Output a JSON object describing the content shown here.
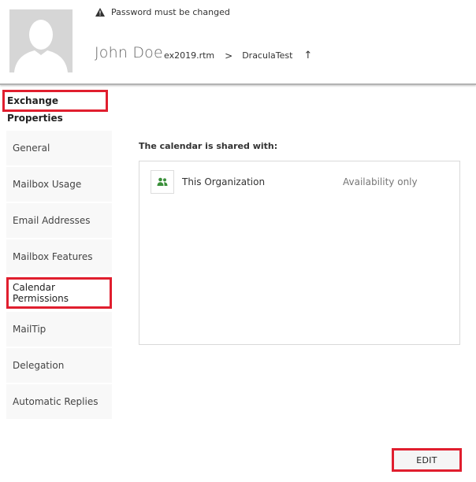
{
  "header": {
    "warning": "Password must be changed",
    "user_name": "John Doe",
    "breadcrumb": [
      "ex2019.rtm",
      "DraculaTest"
    ],
    "breadcrumb_sep": ">",
    "up_glyph": "↑",
    "avatar_icon": "person-silhouette-icon",
    "warning_icon": "warning-triangle-icon"
  },
  "section_title": "Exchange Properties",
  "nav": {
    "items": [
      {
        "label": "General"
      },
      {
        "label": "Mailbox Usage"
      },
      {
        "label": "Email Addresses"
      },
      {
        "label": "Mailbox Features"
      },
      {
        "label": "Calendar Permissions",
        "active": true
      },
      {
        "label": "MailTip"
      },
      {
        "label": "Delegation"
      },
      {
        "label": "Automatic Replies"
      }
    ]
  },
  "calendar": {
    "label": "The calendar is shared with:",
    "entries": [
      {
        "name": "This Organization",
        "level": "Availability only",
        "icon": "people-icon"
      }
    ]
  },
  "edit_label": "EDIT",
  "colors": {
    "highlight": "#e01e2e",
    "people_icon": "#3a8f3a"
  }
}
